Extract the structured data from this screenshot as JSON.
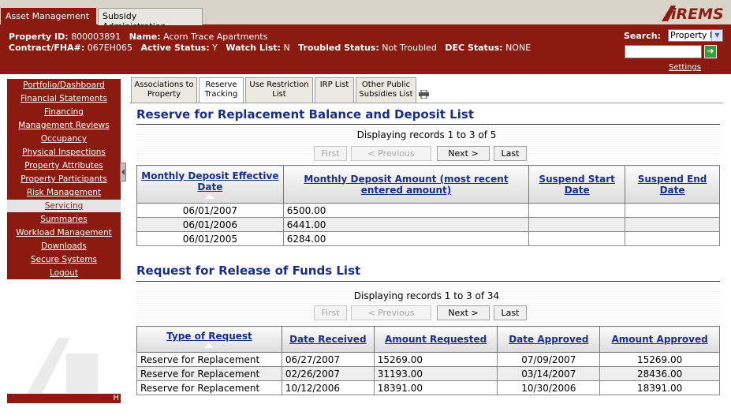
{
  "top_tabs": [
    {
      "label": "Asset Management",
      "active": true
    },
    {
      "label": "Subsidy Administration",
      "active": false
    }
  ],
  "logo_text": "iREMS",
  "header": {
    "property_id_label": "Property ID:",
    "property_id_value": "800003891",
    "name_label": "Name:",
    "name_value": "Acorn Trace Apartments",
    "contract_label": "Contract/FHA#:",
    "contract_value": "067EH065",
    "active_label": "Active Status:",
    "active_value": "Y",
    "watch_label": "Watch List:",
    "watch_value": "N",
    "troubled_label": "Troubled Status:",
    "troubled_value": "Not Troubled",
    "dec_label": "DEC Status:",
    "dec_value": "NONE",
    "search_label": "Search:",
    "search_selected": "Property ID",
    "search_input_value": "",
    "go_icon": "arrow-right-icon",
    "settings_label": "Settings"
  },
  "sidebar": {
    "items": [
      {
        "label": "Portfolio/Dashboard"
      },
      {
        "label": "Financial Statements"
      },
      {
        "label": "Financing"
      },
      {
        "label": "Management Reviews"
      },
      {
        "label": "Occupancy"
      },
      {
        "label": "Physical Inspections"
      },
      {
        "label": "Property Attributes"
      },
      {
        "label": "Property Participants"
      },
      {
        "label": "Risk Management"
      },
      {
        "label": "Servicing",
        "active": true
      },
      {
        "label": "Summaries"
      },
      {
        "label": "Workload Management"
      },
      {
        "label": "Downloads"
      },
      {
        "label": "Secure Systems"
      },
      {
        "label": "Logout"
      }
    ],
    "bottom_text": "H"
  },
  "subtabs": [
    {
      "line1": "Associations to",
      "line2": "Property",
      "active": false
    },
    {
      "line1": "Reserve",
      "line2": "Tracking",
      "active": true
    },
    {
      "line1": "Use Restriction",
      "line2": "List",
      "active": false
    },
    {
      "line1": "",
      "line2": "IRP List",
      "active": false
    },
    {
      "line1": "Other Public",
      "line2": "Subsidies List",
      "active": false
    }
  ],
  "reserve": {
    "title": "Reserve for Replacement Balance and Deposit List",
    "displaying": "Displaying records 1 to 3 of 5",
    "pager": {
      "first": "First",
      "previous": "< Previous",
      "next": "Next >",
      "last": "Last"
    },
    "columns": [
      "Monthly Deposit Effective Date",
      "Monthly Deposit Amount (most recent entered amount)",
      "Suspend Start Date",
      "Suspend End Date"
    ],
    "rows": [
      [
        "06/01/2007",
        "6500.00",
        "",
        ""
      ],
      [
        "06/01/2006",
        "6441.00",
        "",
        ""
      ],
      [
        "06/01/2005",
        "6284.00",
        "",
        ""
      ]
    ]
  },
  "release": {
    "title": "Request for Release of Funds List",
    "displaying": "Displaying records 1 to 3 of 34",
    "pager": {
      "first": "First",
      "previous": "< Previous",
      "next": "Next >",
      "last": "Last"
    },
    "columns": [
      "Type of Request",
      "Date Received",
      "Amount Requested",
      "Date Approved",
      "Amount Approved"
    ],
    "rows": [
      [
        "Reserve for Replacement",
        "06/27/2007",
        "15269.00",
        "07/09/2007",
        "15269.00"
      ],
      [
        "Reserve for Replacement",
        "02/26/2007",
        "31193.00",
        "03/14/2007",
        "28436.00"
      ],
      [
        "Reserve for Replacement",
        "10/12/2006",
        "18391.00",
        "10/30/2006",
        "18391.00"
      ]
    ]
  }
}
